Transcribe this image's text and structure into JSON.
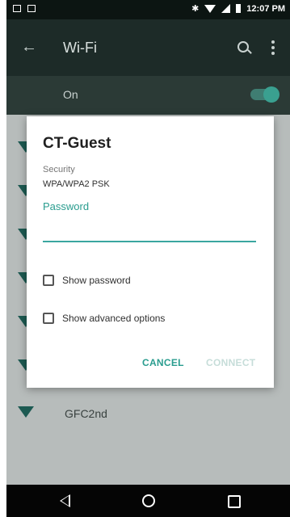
{
  "status_bar": {
    "time": "12:07 PM",
    "icons": [
      "image-icon",
      "notification-icon",
      "bluetooth-icon",
      "wifi-signal-icon",
      "cell-signal-icon",
      "battery-icon"
    ]
  },
  "toolbar": {
    "title": "Wi-Fi",
    "icons": [
      "back-arrow-icon",
      "search-icon",
      "more-vert-icon"
    ]
  },
  "wifi_toggle": {
    "label": "On",
    "state": "on"
  },
  "networks": [
    {
      "name": "GFC2nd"
    }
  ],
  "dialog": {
    "title": "CT-Guest",
    "security_label": "Security",
    "security_value": "WPA/WPA2 PSK",
    "password_label": "Password",
    "password_value": "",
    "show_password_label": "Show password",
    "show_advanced_label": "Show advanced options",
    "cancel_label": "CANCEL",
    "connect_label": "CONNECT"
  },
  "colors": {
    "accent": "#2a9d8f",
    "toolbar": "#1d2b28",
    "disabled_button": "#c6ddd9"
  },
  "nav_bar": {
    "icons": [
      "back-icon",
      "home-icon",
      "recents-icon"
    ]
  }
}
